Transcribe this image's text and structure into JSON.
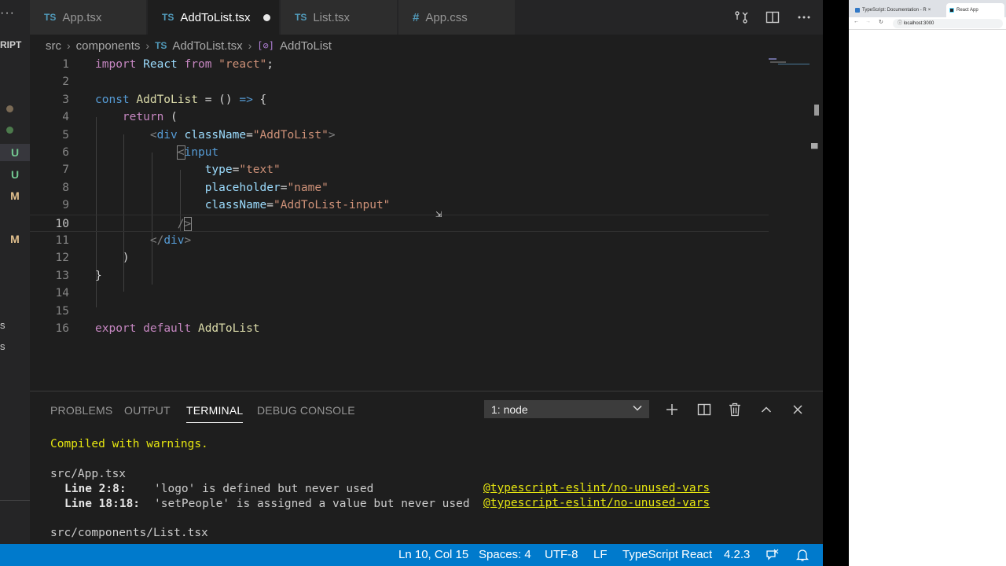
{
  "editor": {
    "tabs": [
      {
        "badge": "TS",
        "label": "App.tsx",
        "active": false,
        "dirty": false
      },
      {
        "badge": "TS",
        "label": "AddToList.tsx",
        "active": true,
        "dirty": true
      },
      {
        "badge": "TS",
        "label": "List.tsx",
        "active": false,
        "dirty": false
      },
      {
        "badge": "#",
        "label": "App.css",
        "active": false,
        "dirty": false
      }
    ],
    "breadcrumb": {
      "folder1": "src",
      "folder2": "components",
      "file_badge": "TS",
      "file": "AddToList.tsx",
      "symbol_icon": "[⊘]",
      "symbol": "AddToList"
    },
    "current_line": 10
  },
  "activity_bar": {
    "ellipsis": "···",
    "explorer_label": "RIPT",
    "git_status": [
      "U",
      "U",
      "M",
      "M"
    ],
    "side_letters": [
      "s",
      "s"
    ]
  },
  "panel": {
    "tabs": [
      "PROBLEMS",
      "OUTPUT",
      "TERMINAL",
      "DEBUG CONSOLE"
    ],
    "active_tab": "TERMINAL",
    "terminal_select": "1: node",
    "terminal": {
      "compiled": "Compiled with warnings.",
      "file1": "src/App.tsx",
      "warnings": [
        {
          "loc": "Line 2:8:",
          "msg": "'logo' is defined but never used",
          "rule": "@typescript-eslint/no-unused-vars"
        },
        {
          "loc": "Line 18:18:",
          "msg": "'setPeople' is assigned a value but never used",
          "rule": "@typescript-eslint/no-unused-vars"
        }
      ],
      "file2": "src/components/List.tsx"
    }
  },
  "statusbar": {
    "position": "Ln 10, Col 15",
    "spaces": "Spaces: 4",
    "encoding": "UTF-8",
    "eol": "LF",
    "language": "TypeScript React",
    "version": "4.2.3"
  },
  "browser": {
    "tab1": "TypeScript: Documentation - R",
    "tab2": "React App",
    "url": "localhost:3000"
  },
  "colors": {
    "statusbar": "#007acc",
    "editor_bg": "#1e1e1e",
    "keyword": "#c586c0",
    "string": "#ce9178",
    "warning": "#e5e510"
  }
}
